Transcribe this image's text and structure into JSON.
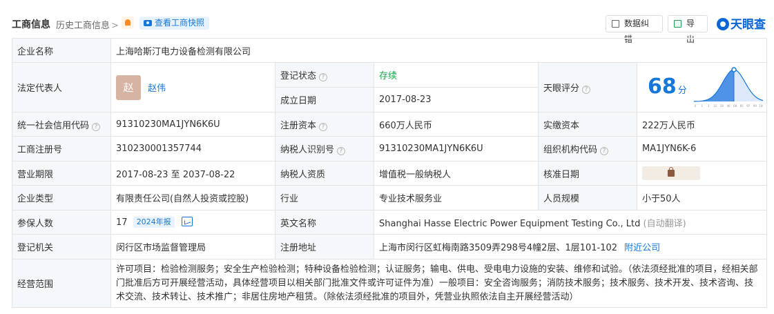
{
  "header": {
    "title": "工商信息",
    "history": "历史工商信息",
    "history_chevron": ">",
    "snapshot": "查看工商快照",
    "correct_btn": "数据纠错",
    "export_btn": "导出",
    "logo": "天眼查"
  },
  "labels": {
    "company_name": "企业名称",
    "legal_rep": "法定代表人",
    "reg_status": "登记状态",
    "est_date": "成立日期",
    "tianyan_score": "天眼评分",
    "credit_code": "统一社会信用代码",
    "reg_capital": "注册资本",
    "paid_capital": "实缴资本",
    "biz_reg_no": "工商注册号",
    "taxpayer_id": "纳税人识别号",
    "org_code": "组织机构代码",
    "biz_term": "营业期限",
    "taxpayer_qual": "纳税人资质",
    "approval_date": "核准日期",
    "company_type": "企业类型",
    "industry": "行业",
    "staff_size": "人员规模",
    "insured": "参保人数",
    "english_name": "英文名称",
    "reg_authority": "登记机关",
    "reg_address": "注册地址",
    "biz_scope": "经营范围"
  },
  "values": {
    "company_name": "上海哈斯汀电力设备检测有限公司",
    "legal_rep_avatar": "赵",
    "legal_rep_name": "赵伟",
    "reg_status": "存续",
    "est_date": "2017-08-23",
    "score": "68",
    "score_unit": "分",
    "credit_code": "91310230MA1JYN6K6U",
    "reg_capital": "660万人民币",
    "paid_capital": "222万人民币",
    "biz_reg_no": "310230001357744",
    "taxpayer_id": "91310230MA1JYN6K6U",
    "org_code": "MA1JYN6K-6",
    "biz_term": "2017-08-23 至 2037-08-22",
    "taxpayer_qual": "增值税一般纳税人",
    "company_type": "有限责任公司(自然人投资或控股)",
    "industry": "专业技术服务业",
    "staff_size": "小于50人",
    "insured_count": "17",
    "insured_year_tag": "2024年报",
    "english_name": "Shanghai Hasse Electric Power Equipment Testing Co., Ltd",
    "auto_translate": "(自动翻译)",
    "reg_authority": "闵行区市场监督管理局",
    "reg_address": "上海市闵行区虹梅南路3509弄298号4幢2层、1层101-102",
    "nearby": "附近公司",
    "biz_scope": "许可项目：检验检测服务；安全生产检验检测；特种设备检验检测；认证服务；输电、供电、受电电力设施的安装、维修和试验。（依法须经批准的项目，经相关部门批准后方可开展经营活动，具体经营项目以相关部门批准文件或许可证件为准）一般项目：安全咨询服务；消防技术服务；技术服务、技术开发、技术咨询、技术交流、技术转让、技术推广；非居住房地产租赁。（除依法须经批准的项目外，凭营业执照依法自主开展经营活动）"
  },
  "score_chart": {
    "x_ticks": [
      "0",
      "1",
      "3",
      "15",
      "28",
      "46",
      "68",
      "85",
      "97",
      "99",
      "100"
    ],
    "marker_score": 68,
    "color": "#1677d9"
  },
  "colors": {
    "accent": "#1677d9",
    "status_green": "#15a64a",
    "label_bg": "#f5f8fb"
  }
}
